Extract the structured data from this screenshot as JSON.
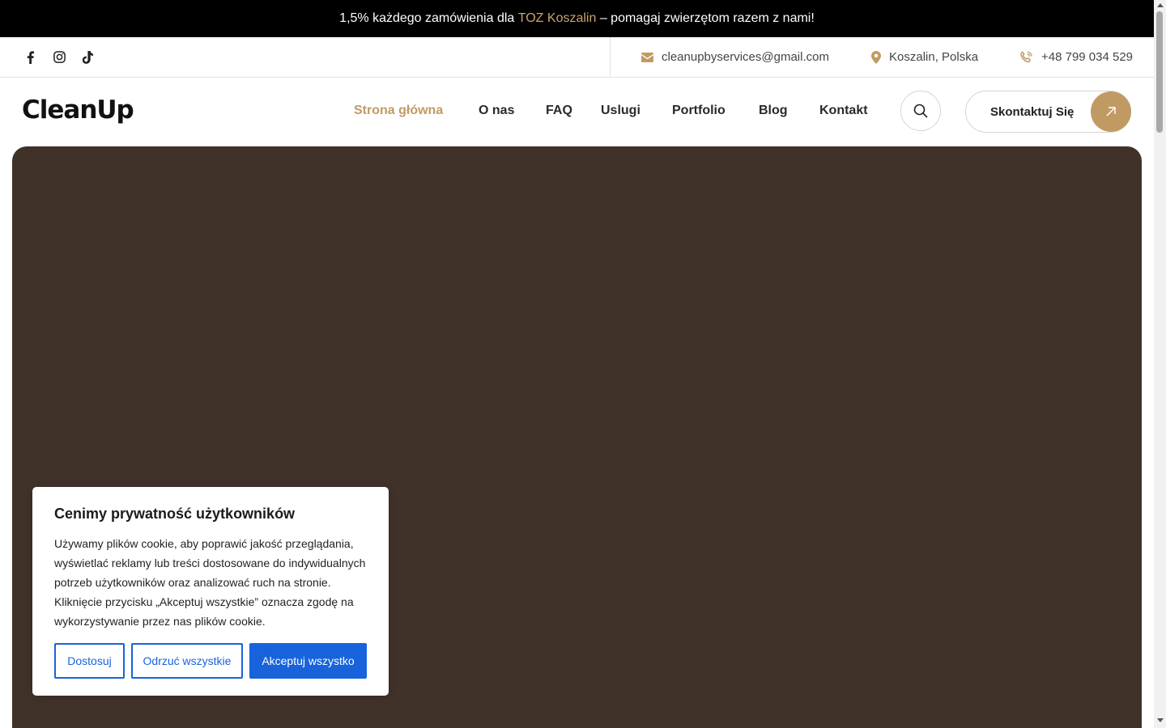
{
  "announcement": {
    "before": "1,5% każdego zamówienia dla ",
    "highlight": "TOZ Koszalin",
    "after": " – pomagaj zwierzętom razem z nami!"
  },
  "topbar": {
    "socials": [
      "facebook-icon",
      "instagram-icon",
      "tiktok-icon"
    ],
    "email": "cleanupbyservices@gmail.com",
    "location": "Koszalin, Polska",
    "phone": "+48 799 034 529"
  },
  "header": {
    "logo": "CleanUp",
    "nav": [
      "Strona główna",
      "O nas",
      "FAQ",
      "Uslugi",
      "Portfolio",
      "Blog",
      "Kontakt"
    ],
    "active_nav": "Strona główna",
    "cta_label": "Skontaktuj Się"
  },
  "cookie_banner": {
    "title": "Cenimy prywatność użytkowników",
    "text": "Używamy plików cookie, aby poprawić jakość przeglądania, wyświetlać reklamy lub treści dostosowane do indywidualnych potrzeb użytkowników oraz analizować ruch na stronie. Kliknięcie przycisku „Akceptuj wszystkie” oznacza zgodę na wykorzystywanie przez nas plików cookie.",
    "customize": "Dostosuj",
    "reject": "Odrzuć wszystkie",
    "accept": "Akceptuj wszystko"
  },
  "colors": {
    "accent": "#c19a63",
    "hero_bg": "#403229",
    "cookie_button": "#1863dc"
  }
}
